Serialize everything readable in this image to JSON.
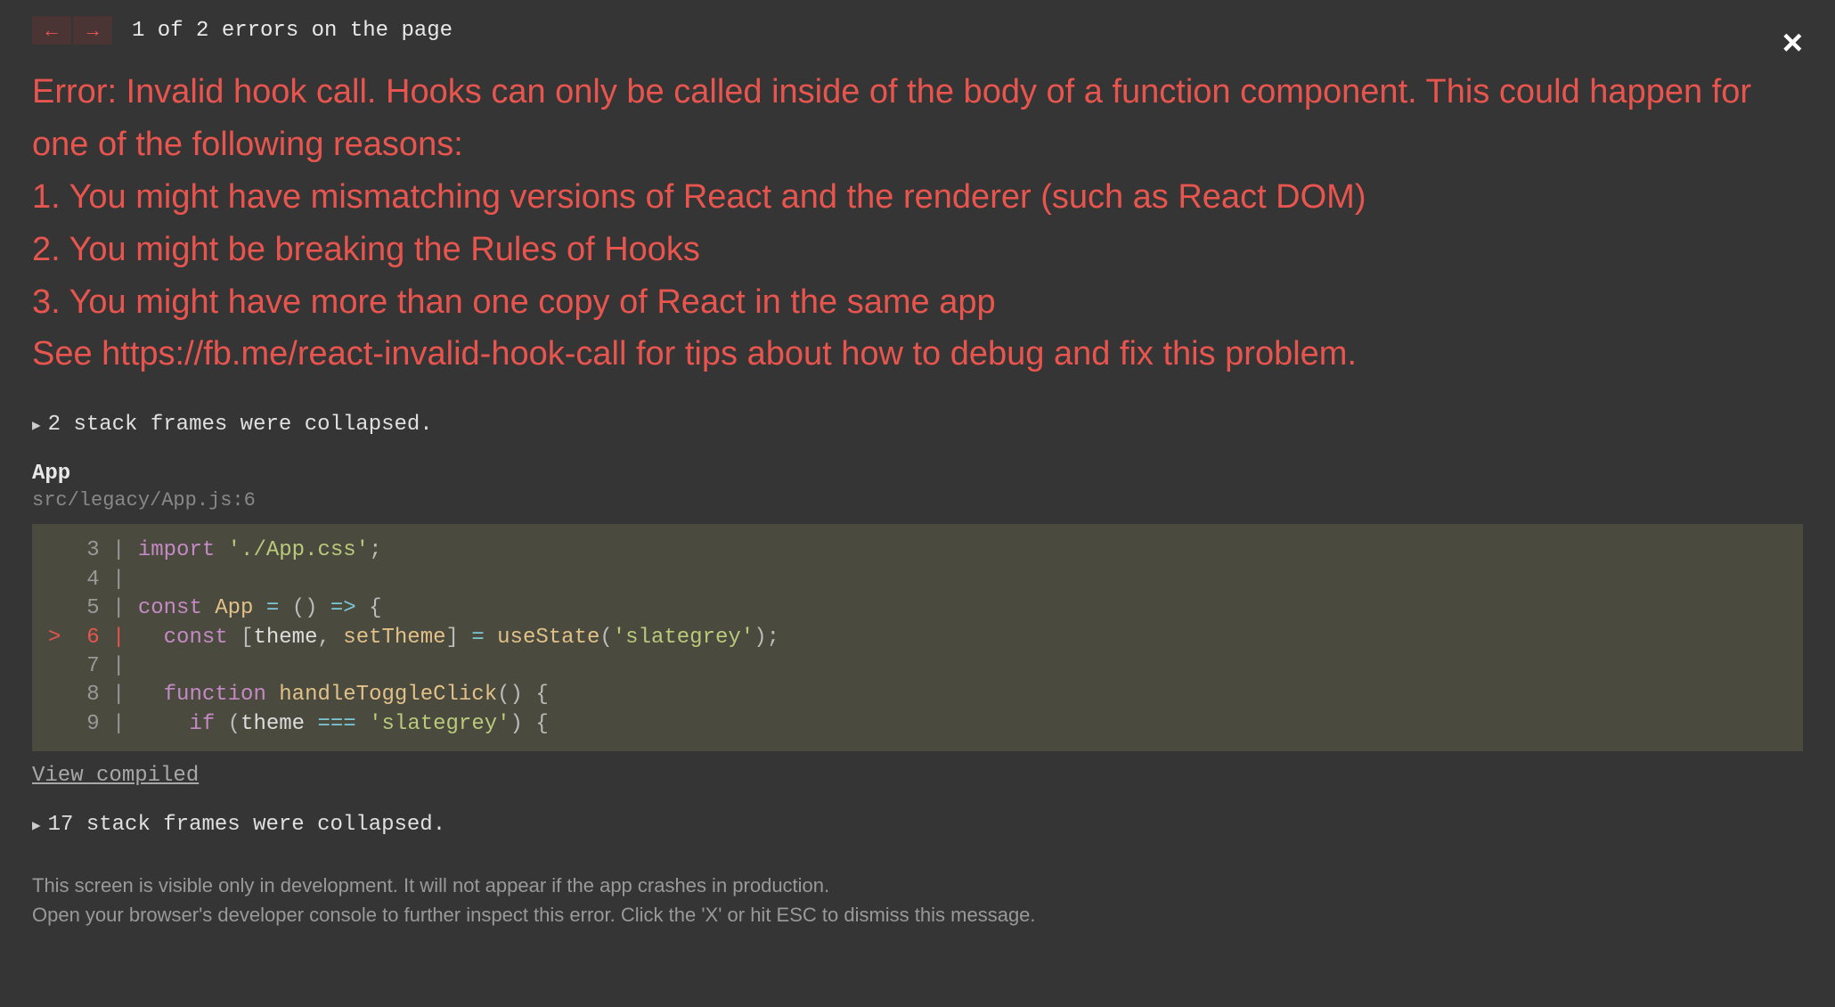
{
  "nav": {
    "prev_arrow": "←",
    "next_arrow": "→",
    "counter": "1 of 2 errors on the page"
  },
  "close_symbol": "×",
  "error_text": "Error: Invalid hook call. Hooks can only be called inside of the body of a function component. This could happen for one of the following reasons:\n1. You might have mismatching versions of React and the renderer (such as React DOM)\n2. You might be breaking the Rules of Hooks\n3. You might have more than one copy of React in the same app\nSee https://fb.me/react-invalid-hook-call for tips about how to debug and fix this problem.",
  "collapsed_top": "2 stack frames were collapsed.",
  "frame": {
    "name": "App",
    "location": "src/legacy/App.js:6"
  },
  "code": {
    "lines": [
      {
        "n": 3,
        "hl": false,
        "tokens": [
          [
            "kw",
            "import"
          ],
          [
            "plain",
            " "
          ],
          [
            "str",
            "'./App.css'"
          ],
          [
            "punct",
            ";"
          ]
        ]
      },
      {
        "n": 4,
        "hl": false,
        "tokens": []
      },
      {
        "n": 5,
        "hl": false,
        "tokens": [
          [
            "kw",
            "const"
          ],
          [
            "plain",
            " "
          ],
          [
            "id",
            "App"
          ],
          [
            "plain",
            " "
          ],
          [
            "op",
            "="
          ],
          [
            "plain",
            " "
          ],
          [
            "punct",
            "()"
          ],
          [
            "plain",
            " "
          ],
          [
            "op",
            "=>"
          ],
          [
            "plain",
            " "
          ],
          [
            "punct",
            "{"
          ]
        ]
      },
      {
        "n": 6,
        "hl": true,
        "tokens": [
          [
            "plain",
            "  "
          ],
          [
            "kw",
            "const"
          ],
          [
            "plain",
            " "
          ],
          [
            "punct",
            "["
          ],
          [
            "plain",
            "theme"
          ],
          [
            "punct",
            ","
          ],
          [
            "plain",
            " "
          ],
          [
            "id",
            "setTheme"
          ],
          [
            "punct",
            "]"
          ],
          [
            "plain",
            " "
          ],
          [
            "op",
            "="
          ],
          [
            "plain",
            " "
          ],
          [
            "fn",
            "useState"
          ],
          [
            "punct",
            "("
          ],
          [
            "str",
            "'slategrey'"
          ],
          [
            "punct",
            ")"
          ],
          [
            "punct",
            ";"
          ]
        ]
      },
      {
        "n": 7,
        "hl": false,
        "tokens": []
      },
      {
        "n": 8,
        "hl": false,
        "tokens": [
          [
            "plain",
            "  "
          ],
          [
            "kw",
            "function"
          ],
          [
            "plain",
            " "
          ],
          [
            "fn",
            "handleToggleClick"
          ],
          [
            "punct",
            "()"
          ],
          [
            "plain",
            " "
          ],
          [
            "punct",
            "{"
          ]
        ]
      },
      {
        "n": 9,
        "hl": false,
        "tokens": [
          [
            "plain",
            "    "
          ],
          [
            "kw",
            "if"
          ],
          [
            "plain",
            " "
          ],
          [
            "punct",
            "("
          ],
          [
            "plain",
            "theme "
          ],
          [
            "op",
            "==="
          ],
          [
            "plain",
            " "
          ],
          [
            "str",
            "'slategrey'"
          ],
          [
            "punct",
            ")"
          ],
          [
            "plain",
            " "
          ],
          [
            "punct",
            "{"
          ]
        ]
      }
    ]
  },
  "view_compiled": "View compiled",
  "collapsed_bottom": "17 stack frames were collapsed.",
  "footer": {
    "line1": "This screen is visible only in development. It will not appear if the app crashes in production.",
    "line2": "Open your browser's developer console to further inspect this error.  Click the 'X' or hit ESC to dismiss this message."
  }
}
